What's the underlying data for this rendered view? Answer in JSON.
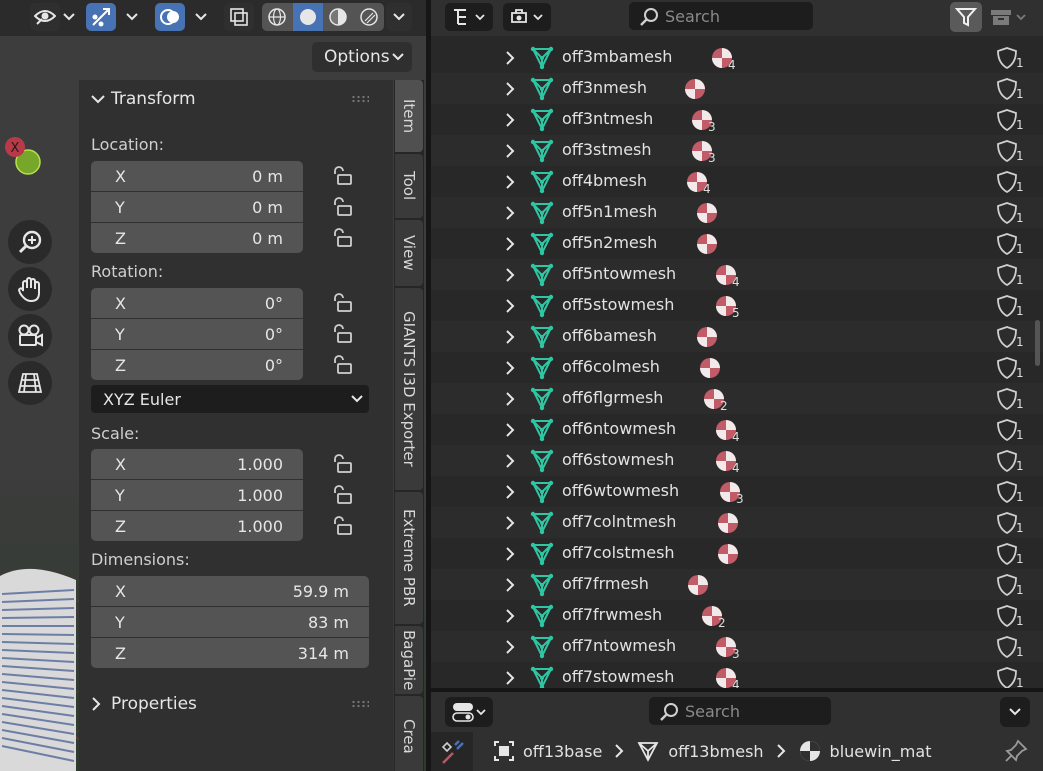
{
  "viewport": {
    "options_label": "Options",
    "gizmo_x_label": "X"
  },
  "sidebar": {
    "tabs": [
      "Item",
      "Tool",
      "View",
      "GIANTS I3D Exporter",
      "Extreme PBR",
      "BagaPie",
      "Crea"
    ],
    "transform": {
      "title": "Transform",
      "location_label": "Location:",
      "location": [
        {
          "axis": "X",
          "value": "0 m"
        },
        {
          "axis": "Y",
          "value": "0 m"
        },
        {
          "axis": "Z",
          "value": "0 m"
        }
      ],
      "rotation_label": "Rotation:",
      "rotation": [
        {
          "axis": "X",
          "value": "0°"
        },
        {
          "axis": "Y",
          "value": "0°"
        },
        {
          "axis": "Z",
          "value": "0°"
        }
      ],
      "rotation_mode": "XYZ Euler",
      "scale_label": "Scale:",
      "scale": [
        {
          "axis": "X",
          "value": "1.000"
        },
        {
          "axis": "Y",
          "value": "1.000"
        },
        {
          "axis": "Z",
          "value": "1.000"
        }
      ],
      "dimensions_label": "Dimensions:",
      "dimensions": [
        {
          "axis": "X",
          "value": "59.9 m"
        },
        {
          "axis": "Y",
          "value": "83 m"
        },
        {
          "axis": "Z",
          "value": "314 m"
        }
      ]
    },
    "properties_title": "Properties"
  },
  "outliner": {
    "search_placeholder": "Search",
    "rows": [
      {
        "name": "off3mbamesh",
        "mat_count": "4",
        "mod_count": "1"
      },
      {
        "name": "off3nmesh",
        "mat_count": "",
        "mod_count": "1"
      },
      {
        "name": "off3ntmesh",
        "mat_count": "3",
        "mod_count": "1"
      },
      {
        "name": "off3stmesh",
        "mat_count": "3",
        "mod_count": "1"
      },
      {
        "name": "off4bmesh",
        "mat_count": "4",
        "mod_count": "1"
      },
      {
        "name": "off5n1mesh",
        "mat_count": "",
        "mod_count": "1"
      },
      {
        "name": "off5n2mesh",
        "mat_count": "",
        "mod_count": "1"
      },
      {
        "name": "off5ntowmesh",
        "mat_count": "4",
        "mod_count": "1"
      },
      {
        "name": "off5stowmesh",
        "mat_count": "5",
        "mod_count": "1"
      },
      {
        "name": "off6bamesh",
        "mat_count": "",
        "mod_count": "1"
      },
      {
        "name": "off6colmesh",
        "mat_count": "",
        "mod_count": "1"
      },
      {
        "name": "off6flgrmesh",
        "mat_count": "2",
        "mod_count": "1"
      },
      {
        "name": "off6ntowmesh",
        "mat_count": "4",
        "mod_count": "1"
      },
      {
        "name": "off6stowmesh",
        "mat_count": "4",
        "mod_count": "1"
      },
      {
        "name": "off6wtowmesh",
        "mat_count": "3",
        "mod_count": "1"
      },
      {
        "name": "off7colntmesh",
        "mat_count": "",
        "mod_count": "1"
      },
      {
        "name": "off7colstmesh",
        "mat_count": "",
        "mod_count": "1"
      },
      {
        "name": "off7frmesh",
        "mat_count": "",
        "mod_count": "1"
      },
      {
        "name": "off7frwmesh",
        "mat_count": "2",
        "mod_count": "1"
      },
      {
        "name": "off7ntowmesh",
        "mat_count": "3",
        "mod_count": "1"
      },
      {
        "name": "off7stowmesh",
        "mat_count": "4",
        "mod_count": "1"
      }
    ]
  },
  "properties": {
    "search_placeholder": "Search",
    "breadcrumb": [
      "off13base",
      "off13bmesh",
      "bluewin_mat"
    ]
  },
  "colors": {
    "accent": "#4772b3",
    "mesh_icon": "#2fc7a3",
    "material_icon": "#c25b68"
  }
}
